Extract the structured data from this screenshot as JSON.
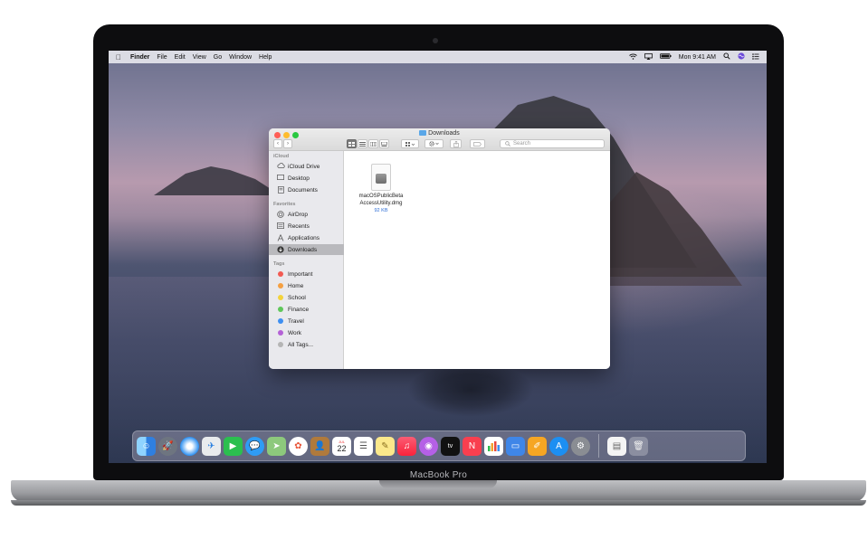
{
  "menubar": {
    "app_name": "Finder",
    "items": [
      "File",
      "Edit",
      "View",
      "Go",
      "Window",
      "Help"
    ],
    "clock": "Mon 9:41 AM"
  },
  "window": {
    "title": "Downloads",
    "search_placeholder": "Search"
  },
  "sidebar": {
    "icloud_heading": "iCloud",
    "icloud_items": [
      "iCloud Drive",
      "Desktop",
      "Documents"
    ],
    "favorites_heading": "Favorites",
    "favorites_items": [
      "AirDrop",
      "Recents",
      "Applications",
      "Downloads"
    ],
    "tags_heading": "Tags",
    "tags": [
      {
        "label": "Important",
        "color": "#f25a52"
      },
      {
        "label": "Home",
        "color": "#f5a042"
      },
      {
        "label": "School",
        "color": "#f3d33b"
      },
      {
        "label": "Finance",
        "color": "#5fc75a"
      },
      {
        "label": "Travel",
        "color": "#3e8ff1"
      },
      {
        "label": "Work",
        "color": "#b461d6"
      },
      {
        "label": "All Tags...",
        "color": "#b5b5b5"
      }
    ]
  },
  "file": {
    "name_line1": "macOSPublicBeta",
    "name_line2": "AccessUtility.dmg",
    "size": "92 KB"
  },
  "dock": {
    "calendar_month": "JUL",
    "calendar_day": "22"
  },
  "laptop_label": "MacBook Pro"
}
